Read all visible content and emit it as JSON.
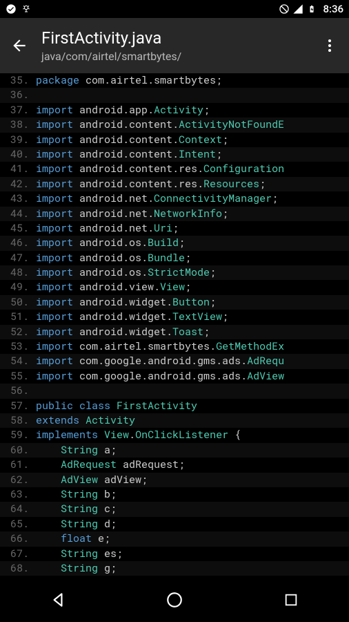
{
  "statusBar": {
    "time": "8:36"
  },
  "appBar": {
    "title": "FirstActivity.java",
    "subtitle": "java/com/airtel/smartbytes/"
  },
  "code": {
    "startLine": 35,
    "lines": [
      [
        {
          "t": "package ",
          "c": "kw"
        },
        {
          "t": "com.airtel.smartbytes",
          "c": "pkg"
        },
        {
          "t": ";",
          "c": "punct"
        }
      ],
      [],
      [
        {
          "t": "import ",
          "c": "kw"
        },
        {
          "t": "android.app.",
          "c": "pkg"
        },
        {
          "t": "Activity",
          "c": "cls"
        },
        {
          "t": ";",
          "c": "punct"
        }
      ],
      [
        {
          "t": "import ",
          "c": "kw"
        },
        {
          "t": "android.content.",
          "c": "pkg"
        },
        {
          "t": "ActivityNotFoundE",
          "c": "cls"
        }
      ],
      [
        {
          "t": "import ",
          "c": "kw"
        },
        {
          "t": "android.content.",
          "c": "pkg"
        },
        {
          "t": "Context",
          "c": "cls"
        },
        {
          "t": ";",
          "c": "punct"
        }
      ],
      [
        {
          "t": "import ",
          "c": "kw"
        },
        {
          "t": "android.content.",
          "c": "pkg"
        },
        {
          "t": "Intent",
          "c": "cls"
        },
        {
          "t": ";",
          "c": "punct"
        }
      ],
      [
        {
          "t": "import ",
          "c": "kw"
        },
        {
          "t": "android.content.res.",
          "c": "pkg"
        },
        {
          "t": "Configuration",
          "c": "cls"
        }
      ],
      [
        {
          "t": "import ",
          "c": "kw"
        },
        {
          "t": "android.content.res.",
          "c": "pkg"
        },
        {
          "t": "Resources",
          "c": "cls"
        },
        {
          "t": ";",
          "c": "punct"
        }
      ],
      [
        {
          "t": "import ",
          "c": "kw"
        },
        {
          "t": "android.net.",
          "c": "pkg"
        },
        {
          "t": "ConnectivityManager",
          "c": "cls"
        },
        {
          "t": ";",
          "c": "punct"
        }
      ],
      [
        {
          "t": "import ",
          "c": "kw"
        },
        {
          "t": "android.net.",
          "c": "pkg"
        },
        {
          "t": "NetworkInfo",
          "c": "cls"
        },
        {
          "t": ";",
          "c": "punct"
        }
      ],
      [
        {
          "t": "import ",
          "c": "kw"
        },
        {
          "t": "android.net.",
          "c": "pkg"
        },
        {
          "t": "Uri",
          "c": "cls"
        },
        {
          "t": ";",
          "c": "punct"
        }
      ],
      [
        {
          "t": "import ",
          "c": "kw"
        },
        {
          "t": "android.os.",
          "c": "pkg"
        },
        {
          "t": "Build",
          "c": "cls"
        },
        {
          "t": ";",
          "c": "punct"
        }
      ],
      [
        {
          "t": "import ",
          "c": "kw"
        },
        {
          "t": "android.os.",
          "c": "pkg"
        },
        {
          "t": "Bundle",
          "c": "cls"
        },
        {
          "t": ";",
          "c": "punct"
        }
      ],
      [
        {
          "t": "import ",
          "c": "kw"
        },
        {
          "t": "android.os.",
          "c": "pkg"
        },
        {
          "t": "StrictMode",
          "c": "cls"
        },
        {
          "t": ";",
          "c": "punct"
        }
      ],
      [
        {
          "t": "import ",
          "c": "kw"
        },
        {
          "t": "android.view.",
          "c": "pkg"
        },
        {
          "t": "View",
          "c": "cls"
        },
        {
          "t": ";",
          "c": "punct"
        }
      ],
      [
        {
          "t": "import ",
          "c": "kw"
        },
        {
          "t": "android.widget.",
          "c": "pkg"
        },
        {
          "t": "Button",
          "c": "cls"
        },
        {
          "t": ";",
          "c": "punct"
        }
      ],
      [
        {
          "t": "import ",
          "c": "kw"
        },
        {
          "t": "android.widget.",
          "c": "pkg"
        },
        {
          "t": "TextView",
          "c": "cls"
        },
        {
          "t": ";",
          "c": "punct"
        }
      ],
      [
        {
          "t": "import ",
          "c": "kw"
        },
        {
          "t": "android.widget.",
          "c": "pkg"
        },
        {
          "t": "Toast",
          "c": "cls"
        },
        {
          "t": ";",
          "c": "punct"
        }
      ],
      [
        {
          "t": "import ",
          "c": "kw"
        },
        {
          "t": "com.airtel.smartbytes.",
          "c": "pkg"
        },
        {
          "t": "GetMethodEx",
          "c": "cls"
        }
      ],
      [
        {
          "t": "import ",
          "c": "kw"
        },
        {
          "t": "com.google.android.gms.ads.",
          "c": "pkg"
        },
        {
          "t": "AdRequ",
          "c": "cls"
        }
      ],
      [
        {
          "t": "import ",
          "c": "kw"
        },
        {
          "t": "com.google.android.gms.ads.",
          "c": "pkg"
        },
        {
          "t": "AdView",
          "c": "cls"
        }
      ],
      [],
      [
        {
          "t": "public class ",
          "c": "kw"
        },
        {
          "t": "FirstActivity",
          "c": "cls"
        }
      ],
      [
        {
          "t": "extends ",
          "c": "kw"
        },
        {
          "t": "Activity",
          "c": "cls"
        }
      ],
      [
        {
          "t": "implements ",
          "c": "kw"
        },
        {
          "t": "View",
          "c": "cls"
        },
        {
          "t": ".",
          "c": "punct"
        },
        {
          "t": "OnClickListener",
          "c": "cls"
        },
        {
          "t": " {",
          "c": "punct"
        }
      ],
      [
        {
          "t": "    ",
          "c": "pkg"
        },
        {
          "t": "String",
          "c": "type"
        },
        {
          "t": " a;",
          "c": "ident"
        }
      ],
      [
        {
          "t": "    ",
          "c": "pkg"
        },
        {
          "t": "AdRequest",
          "c": "type"
        },
        {
          "t": " adRequest;",
          "c": "ident"
        }
      ],
      [
        {
          "t": "    ",
          "c": "pkg"
        },
        {
          "t": "AdView",
          "c": "type"
        },
        {
          "t": " adView;",
          "c": "ident"
        }
      ],
      [
        {
          "t": "    ",
          "c": "pkg"
        },
        {
          "t": "String",
          "c": "type"
        },
        {
          "t": " b;",
          "c": "ident"
        }
      ],
      [
        {
          "t": "    ",
          "c": "pkg"
        },
        {
          "t": "String",
          "c": "type"
        },
        {
          "t": " c;",
          "c": "ident"
        }
      ],
      [
        {
          "t": "    ",
          "c": "pkg"
        },
        {
          "t": "String",
          "c": "type"
        },
        {
          "t": " d;",
          "c": "ident"
        }
      ],
      [
        {
          "t": "    ",
          "c": "pkg"
        },
        {
          "t": "float",
          "c": "kw"
        },
        {
          "t": " e;",
          "c": "ident"
        }
      ],
      [
        {
          "t": "    ",
          "c": "pkg"
        },
        {
          "t": "String",
          "c": "type"
        },
        {
          "t": " es;",
          "c": "ident"
        }
      ],
      [
        {
          "t": "    ",
          "c": "pkg"
        },
        {
          "t": "String",
          "c": "type"
        },
        {
          "t": " g;",
          "c": "ident"
        }
      ]
    ]
  }
}
